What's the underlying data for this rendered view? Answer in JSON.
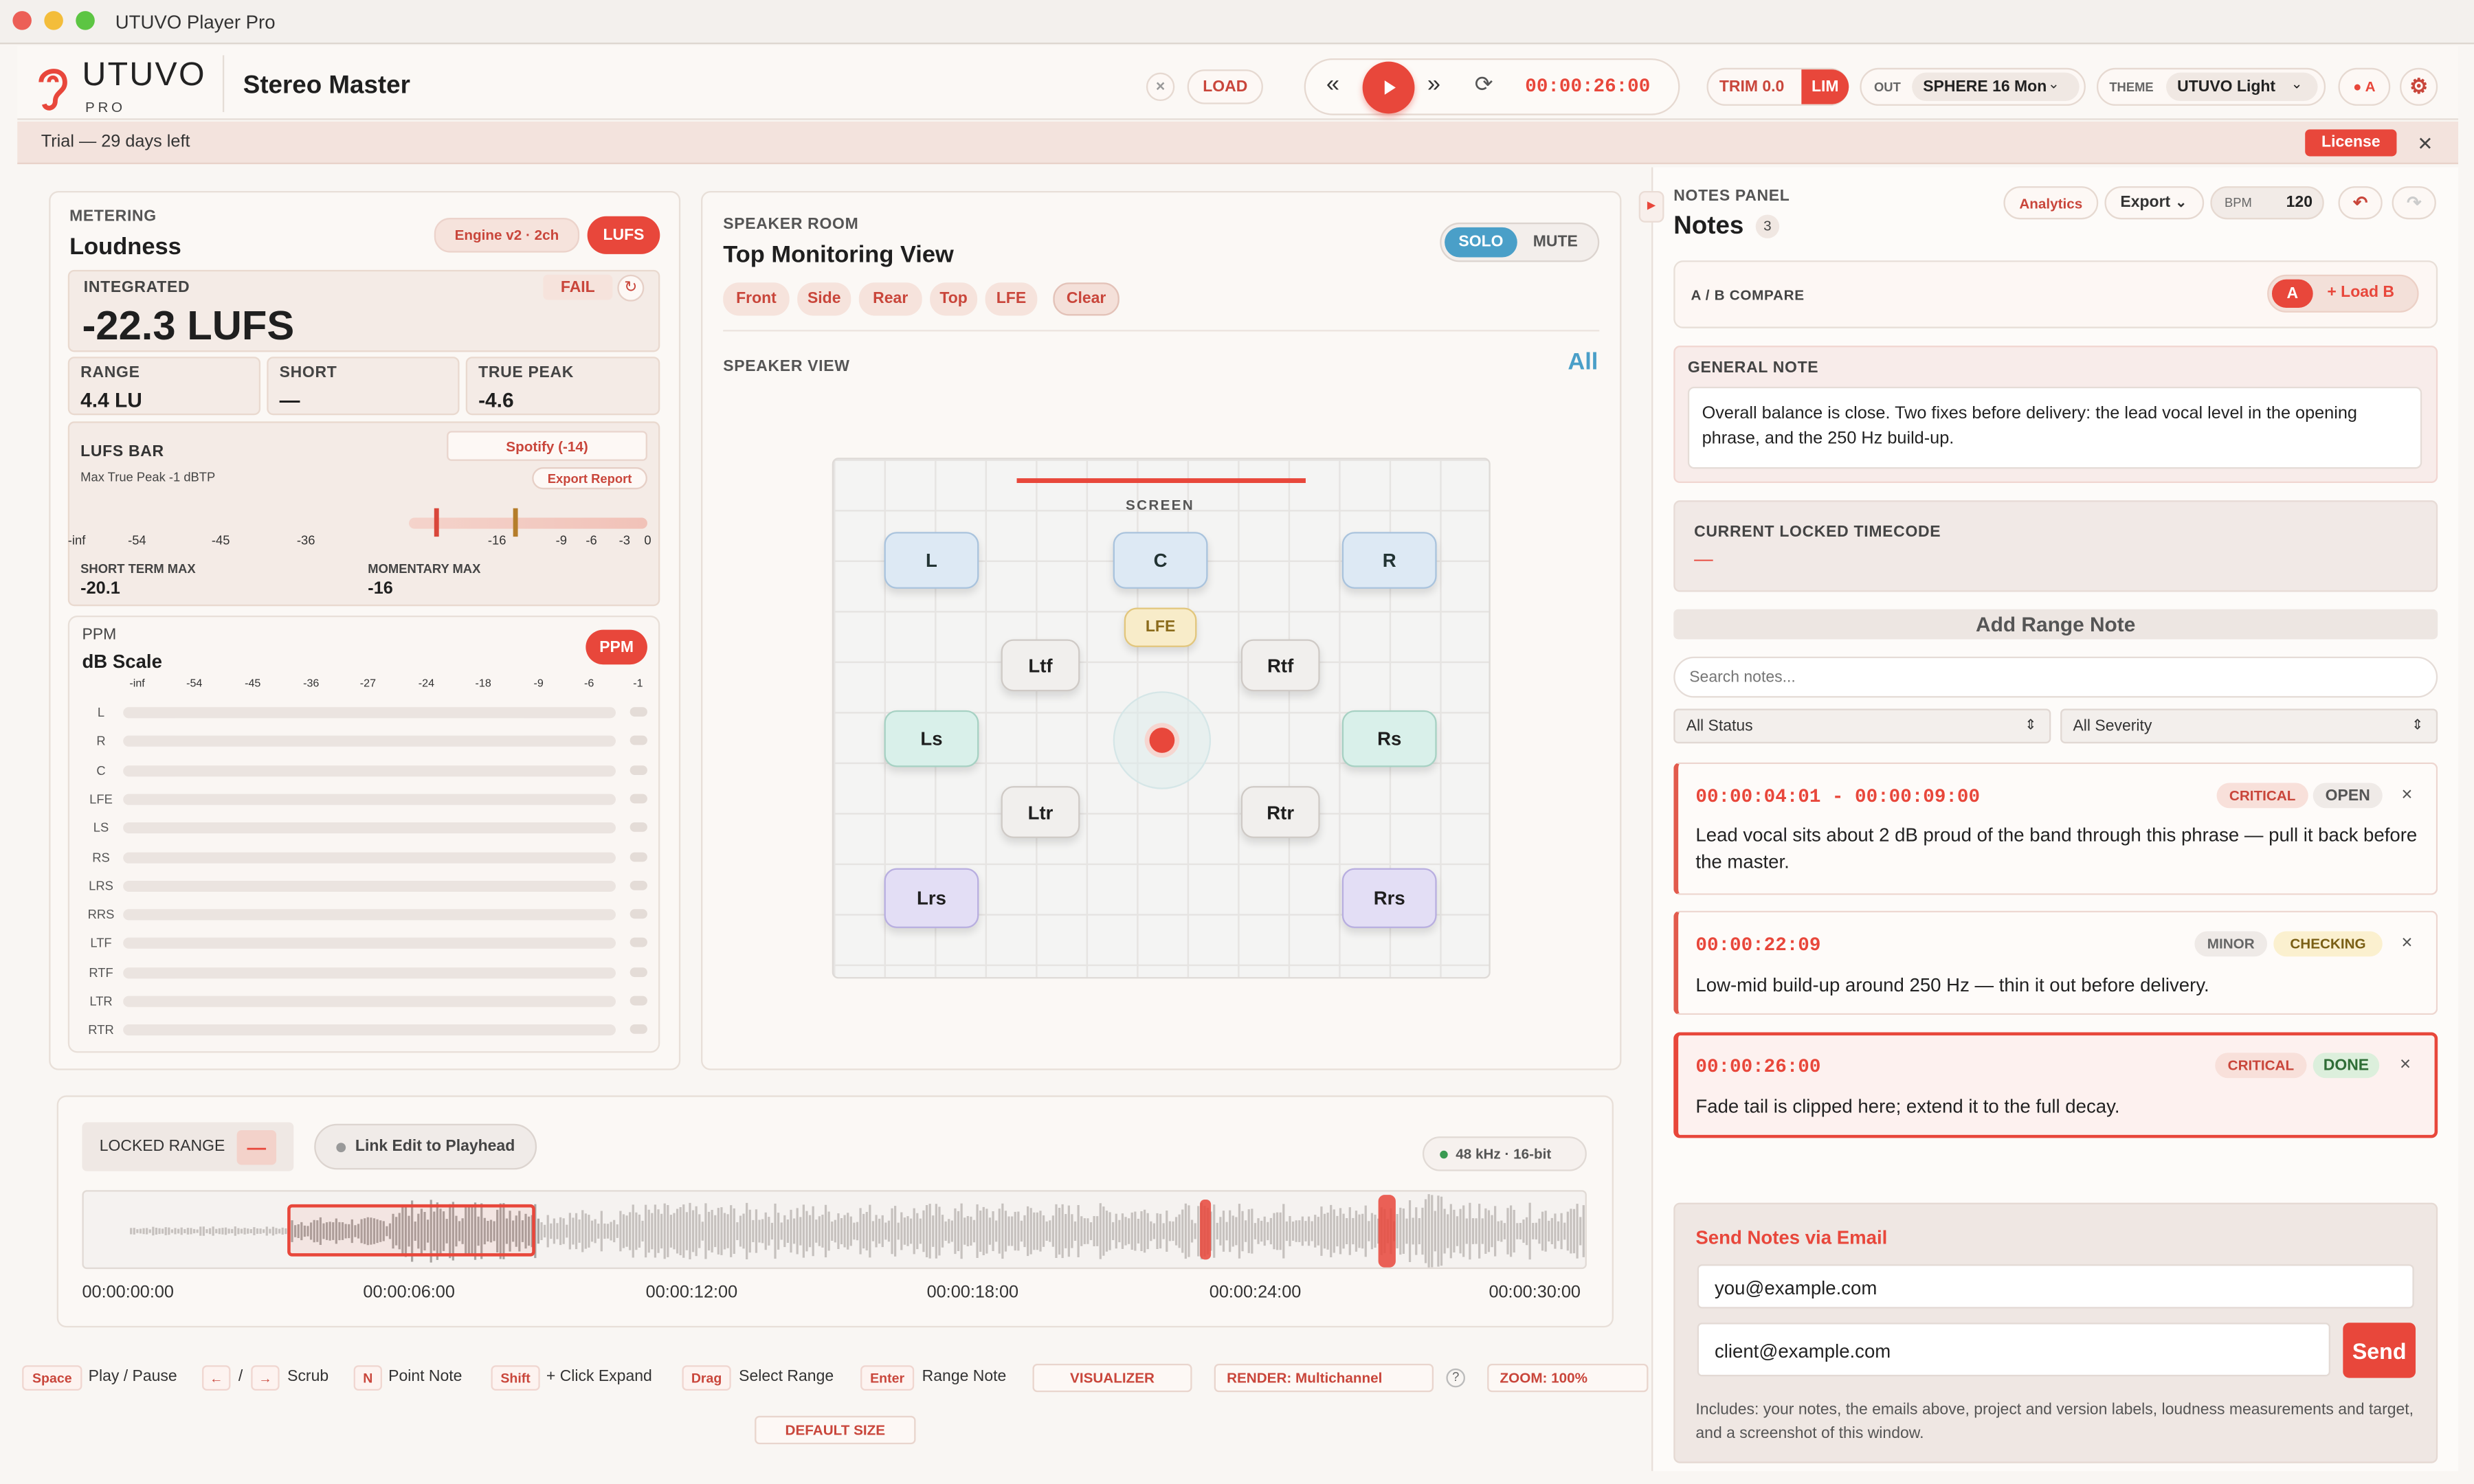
{
  "window": {
    "title": "UTUVO Player Pro"
  },
  "brand": {
    "name": "UTUVO",
    "sub": "PRO"
  },
  "header": {
    "project": "Stereo Master",
    "close": "×",
    "load": "LOAD",
    "timecode": "00:00:26:00",
    "trim": "TRIM 0.0",
    "lim": "LIM",
    "out_label": "OUT",
    "out_value": "SPHERE 16 Mon",
    "theme_label": "THEME",
    "theme_value": "UTUVO Light",
    "ab": "● A"
  },
  "trial": {
    "text": "Trial — 29 days left",
    "license": "License",
    "close": "✕"
  },
  "metering": {
    "section": "METERING",
    "title": "Loudness",
    "engine": "Engine v2 · 2ch",
    "lufs": "LUFS",
    "integrated_label": "INTEGRATED",
    "integrated_value": "-22.3 LUFS",
    "fail": "FAIL",
    "range_label": "RANGE",
    "range_value": "4.4 LU",
    "short_label": "SHORT",
    "short_value": "—",
    "tp_label": "TRUE PEAK",
    "tp_value": "-4.6",
    "bar_title": "LUFS BAR",
    "bar_sub": "Max True Peak -1 dBTP",
    "target": "Spotify (-14)",
    "export": "Export Report",
    "scale": [
      "-inf",
      "-54",
      "-45",
      "-36",
      "-16",
      "-9",
      "-6",
      "-3",
      "0"
    ],
    "stm_label": "SHORT TERM MAX",
    "stm_value": "-20.1",
    "mm_label": "MOMENTARY MAX",
    "mm_value": "-16",
    "ppm_label": "PPM",
    "ppm_title": "dB Scale",
    "ppm_btn": "PPM",
    "ppm_scale": [
      "-inf",
      "-54",
      "-45",
      "-36",
      "-27",
      "-24",
      "-18",
      "-9",
      "-6",
      "-1"
    ],
    "channels": [
      "L",
      "R",
      "C",
      "LFE",
      "LS",
      "RS",
      "LRS",
      "RRS",
      "LTF",
      "RTF",
      "LTR",
      "RTR"
    ]
  },
  "room": {
    "section": "SPEAKER ROOM",
    "title": "Top Monitoring View",
    "solo": "SOLO",
    "mute": "MUTE",
    "filters": [
      "Front",
      "Side",
      "Rear",
      "Top",
      "LFE",
      "Clear"
    ],
    "view_label": "SPEAKER VIEW",
    "all": "All",
    "screen": "SCREEN",
    "speakers": {
      "L": "L",
      "C": "C",
      "R": "R",
      "LFE": "LFE",
      "Ltf": "Ltf",
      "Rtf": "Rtf",
      "Ls": "Ls",
      "Rs": "Rs",
      "Ltr": "Ltr",
      "Rtr": "Rtr",
      "Lrs": "Lrs",
      "Rrs": "Rrs"
    }
  },
  "timeline": {
    "locked": "LOCKED RANGE",
    "locked_btn": "—",
    "link": "Link Edit to Playhead",
    "format": "48 kHz · 16-bit",
    "ticks": [
      "00:00:00:00",
      "00:00:06:00",
      "00:00:12:00",
      "00:00:18:00",
      "00:00:24:00",
      "00:00:30:00"
    ]
  },
  "shortcuts": {
    "k1": "Space",
    "t1": "Play / Pause",
    "k2": "←",
    "slash": "/",
    "k3": "→",
    "t3": "Scrub",
    "k4": "N",
    "t4": "Point Note",
    "k5": "Shift",
    "t5": "+ Click Expand",
    "k6": "Drag",
    "t6": "Select Range",
    "k7": "Enter",
    "t7": "Range Note",
    "visualizer": "VISUALIZER",
    "render": "RENDER: Multichannel",
    "help": "?",
    "zoom": "ZOOM: 100%",
    "default": "DEFAULT SIZE"
  },
  "notes": {
    "section": "NOTES PANEL",
    "title": "Notes",
    "count": "3",
    "analytics": "Analytics",
    "export": "Export",
    "bpm_label": "BPM",
    "bpm": "120",
    "ab_label": "A / B COMPARE",
    "ab_a": "A",
    "ab_load": "+ Load B",
    "general_label": "GENERAL NOTE",
    "general_text": "Overall balance is close. Two fixes before delivery: the lead vocal level in the opening phrase, and the 250 Hz build-up.",
    "locked_label": "CURRENT LOCKED TIMECODE",
    "locked_value": "—",
    "add": "Add Range Note",
    "search_ph": "Search notes...",
    "status": "All Status",
    "severity": "All Severity",
    "items": [
      {
        "time": "00:00:04:01 - 00:00:09:00",
        "sev": "CRITICAL",
        "state": "OPEN",
        "text": "Lead vocal sits about 2 dB proud of the band through this phrase — pull it back before the master."
      },
      {
        "time": "00:00:22:09",
        "sev": "MINOR",
        "state": "CHECKING",
        "text": "Low-mid build-up around 250 Hz — thin it out before delivery."
      },
      {
        "time": "00:00:26:00",
        "sev": "CRITICAL",
        "state": "DONE",
        "text": "Fade tail is clipped here; extend it to the full decay."
      }
    ],
    "email_title": "Send Notes via Email",
    "email1": "you@example.com",
    "email2": "client@example.com",
    "send": "Send",
    "email_info": "Includes: your notes, the emails above, project and version labels, loudness measurements and target, and a screenshot of this window."
  },
  "colors": {
    "accent": "#e8473b",
    "blue": "#4a9fc8"
  }
}
